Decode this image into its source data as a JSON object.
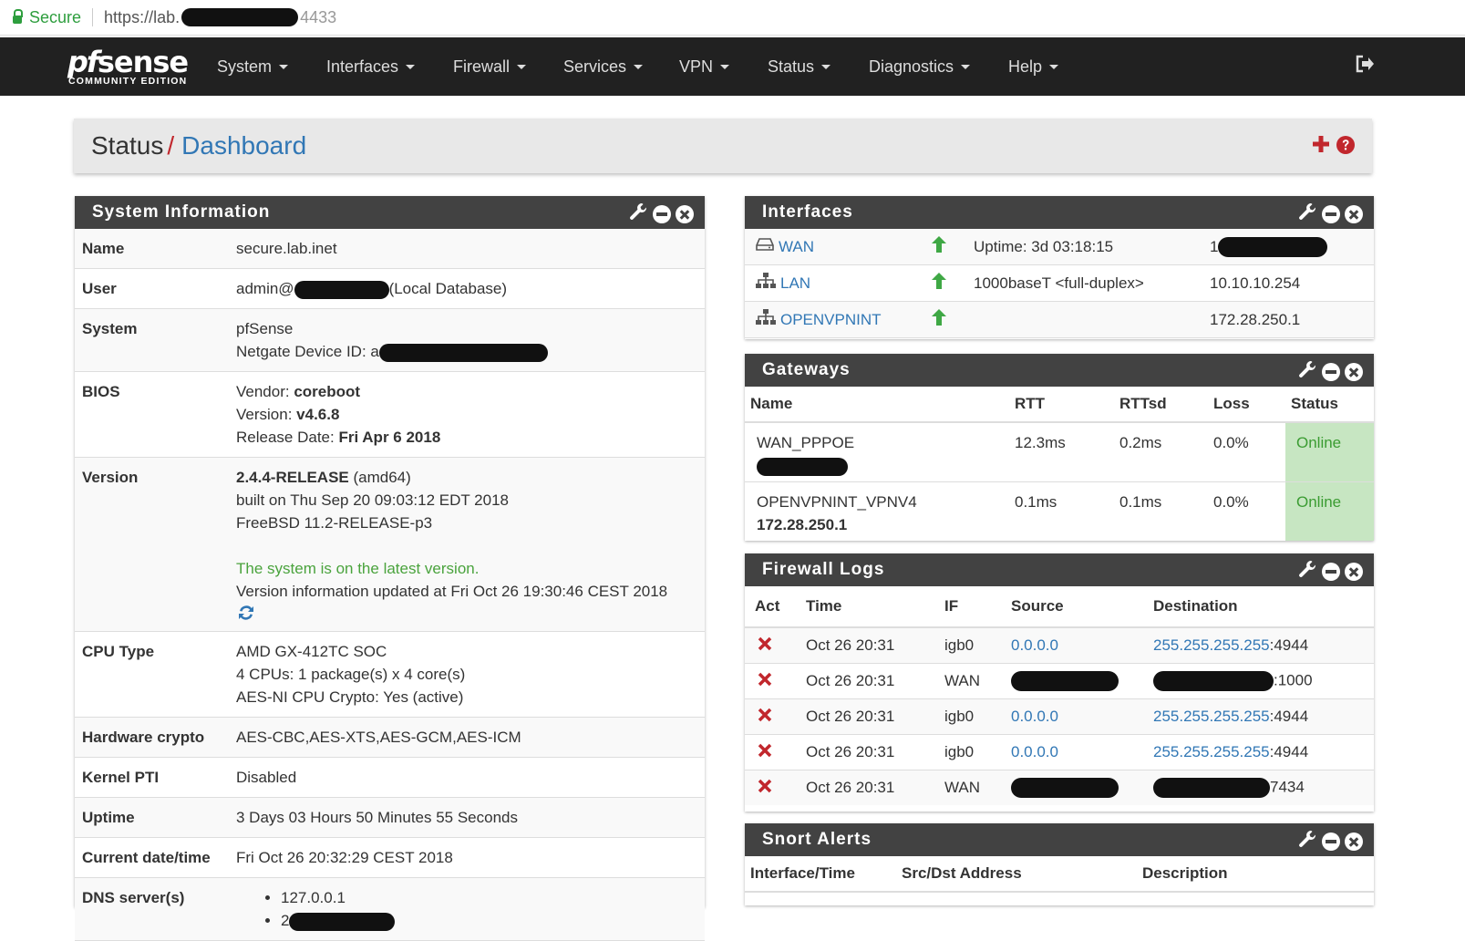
{
  "browser": {
    "secure_label": "Secure",
    "url_prefix": "https://lab.",
    "url_suffix": "4433"
  },
  "nav": {
    "logo_pf": "pf",
    "logo_sense": "sense",
    "logo_edition": "COMMUNITY EDITION",
    "items": [
      "System",
      "Interfaces",
      "Firewall",
      "Services",
      "VPN",
      "Status",
      "Diagnostics",
      "Help"
    ]
  },
  "breadcrumb": {
    "parent": "Status",
    "separator": "/",
    "current": "Dashboard"
  },
  "sysinfo": {
    "title": "System Information",
    "name_label": "Name",
    "name_value": "secure.lab.inet",
    "user_label": "User",
    "user_prefix": "admin@",
    "user_suffix": "(Local Database)",
    "system_label": "System",
    "system_value": "pfSense",
    "device_id_label": "Netgate Device ID:",
    "device_id_value": "a",
    "bios_label": "BIOS",
    "bios_vendor_label": "Vendor:",
    "bios_vendor": "coreboot",
    "bios_version_label": "Version:",
    "bios_version": "v4.6.8",
    "bios_date_label": "Release Date:",
    "bios_date": "Fri Apr 6 2018",
    "version_label": "Version",
    "version_release": "2.4.4-RELEASE",
    "version_arch": "(amd64)",
    "version_built": "built on Thu Sep 20 09:03:12 EDT 2018",
    "version_freebsd": "FreeBSD 11.2-RELEASE-p3",
    "version_latest": "The system is on the latest version.",
    "version_updated": "Version information updated at Fri Oct 26 19:30:46 CEST 2018",
    "cpu_label": "CPU Type",
    "cpu_model": "AMD GX-412TC SOC",
    "cpu_cores": "4 CPUs: 1 package(s) x 4 core(s)",
    "cpu_aesni": "AES-NI CPU Crypto: Yes (active)",
    "hwcrypto_label": "Hardware crypto",
    "hwcrypto_value": "AES-CBC,AES-XTS,AES-GCM,AES-ICM",
    "pti_label": "Kernel PTI",
    "pti_value": "Disabled",
    "uptime_label": "Uptime",
    "uptime_value": "3 Days 03 Hours 50 Minutes 55 Seconds",
    "datetime_label": "Current date/time",
    "datetime_value": "Fri Oct 26 20:32:29 CEST 2018",
    "dns_label": "DNS server(s)",
    "dns_1": "127.0.0.1",
    "dns_2_prefix": "2"
  },
  "interfaces": {
    "title": "Interfaces",
    "rows": [
      {
        "name": "WAN",
        "info": "Uptime: 3d 03:18:15",
        "ip": "1"
      },
      {
        "name": "LAN",
        "info": "1000baseT <full-duplex>",
        "ip": "10.10.10.254"
      },
      {
        "name": "OPENVPNINT",
        "info": "",
        "ip": "172.28.250.1"
      }
    ]
  },
  "gateways": {
    "title": "Gateways",
    "headers": [
      "Name",
      "RTT",
      "RTTsd",
      "Loss",
      "Status"
    ],
    "rows": [
      {
        "name": "WAN_PPPOE",
        "addr": "",
        "rtt": "12.3ms",
        "rttsd": "0.2ms",
        "loss": "0.0%",
        "status": "Online"
      },
      {
        "name": "OPENVPNINT_VPNV4",
        "addr": "172.28.250.1",
        "rtt": "0.1ms",
        "rttsd": "0.1ms",
        "loss": "0.0%",
        "status": "Online"
      }
    ]
  },
  "firewall_logs": {
    "title": "Firewall Logs",
    "headers": [
      "Act",
      "Time",
      "IF",
      "Source",
      "Destination"
    ],
    "rows": [
      {
        "time": "Oct 26 20:31",
        "if": "igb0",
        "source": "0.0.0.0",
        "dest": "255.255.255.255",
        "port": ":4944"
      },
      {
        "time": "Oct 26 20:31",
        "if": "WAN",
        "source": "",
        "dest": "",
        "port": ":1000"
      },
      {
        "time": "Oct 26 20:31",
        "if": "igb0",
        "source": "0.0.0.0",
        "dest": "255.255.255.255",
        "port": ":4944"
      },
      {
        "time": "Oct 26 20:31",
        "if": "igb0",
        "source": "0.0.0.0",
        "dest": "255.255.255.255",
        "port": ":4944"
      },
      {
        "time": "Oct 26 20:31",
        "if": "WAN",
        "source": "",
        "dest": "",
        "port": "7434"
      }
    ]
  },
  "snort": {
    "title": "Snort Alerts",
    "headers": [
      "Interface/Time",
      "Src/Dst Address",
      "Description"
    ]
  },
  "colors": {
    "navbar": "#212121",
    "panel_header": "#424242",
    "link": "#3177b5",
    "green": "#4aa33d",
    "online_bg": "#c7e6c2",
    "red": "#c1272d",
    "arrow_green": "#3fa845"
  }
}
